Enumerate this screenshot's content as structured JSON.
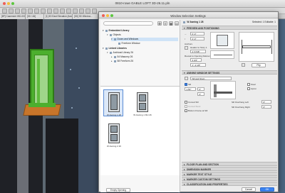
{
  "app": {
    "title": "0810-rowe GABLE LOFT 3D-26.11.pln",
    "tabs": [
      "[8P] Casement WD-000.33",
      "[3D / All]",
      "[1] 3D East Elevation [Auto...]",
      "[3D] 3D Window..."
    ]
  },
  "dialog": {
    "title": "Window Selection Settings",
    "selected_label": "W Awning 1 28",
    "selected_count": "Selected: 1 Editable: 1",
    "search_placeholder": "",
    "tree": [
      {
        "label": "Embedded Library",
        "bold": true
      },
      {
        "label": "Objects",
        "bold": false
      },
      {
        "label": "Doors and Windows",
        "bold": false
      },
      {
        "label": "Freeform Window",
        "bold": false
      },
      {
        "label": "Linked Libraries",
        "bold": true
      },
      {
        "label": "Archicad Library 26",
        "bold": false
      },
      {
        "label": "54 Masonry 26",
        "bold": false
      },
      {
        "label": "58 Freeform 26",
        "bold": false
      }
    ],
    "thumbnails": [
      {
        "label": "W Awning 1 28",
        "selected": true
      },
      {
        "label": "W Awning 1 MU 26",
        "selected": false
      },
      {
        "label": "W Awning 2 26",
        "selected": false
      }
    ],
    "empty_opening_button": "Empty Opening",
    "preview": {
      "header": "PREVIEW AND POSITIONING",
      "width_value": "0'-0\"",
      "height_value": "2'-0\"",
      "anchors_label": "Anchors",
      "header_ref_label": "Header to Story 1",
      "header_value": "4'-5 5/8\"",
      "reveal_label": "Reveal to Opening Reference",
      "reveal_value": "3 3/4\"",
      "sill_value": "1' -2 1/8\"",
      "flip_button": "Flip"
    },
    "awning": {
      "header": "AWNING WINDOW SETTINGS",
      "dropdown_label": "Sill and Stool...",
      "sill_checkbox": "Sill",
      "sill_checked": true,
      "stool_checkbox": "Stool",
      "stool_checked": false,
      "apron_label": "Apron",
      "sill_thickness": "1.50\"",
      "val_a": "0\"",
      "sill_depth": "2\"",
      "curved_sill": "Curved Sill",
      "curved_stool": "Curved Stool",
      "bottom_frame": "Bottom Frame at Sill",
      "overhang_left_label": "Sill Overhang Left",
      "overhang_right_label": "Sill Overhang Right",
      "overhang_left": "0\"",
      "overhang_right": "0\""
    },
    "sections": [
      "FLOOR PLAN AND SECTION",
      "DIMENSION MARKER",
      "MARKER TEXT STYLE",
      "MARKER CUSTOM SETTINGS",
      "CLASSIFICATION AND PROPERTIES"
    ],
    "cancel_label": "Cancel",
    "ok_label": "OK"
  },
  "colors": {
    "accent": "#3a82f0",
    "selection_green": "#4caf2e",
    "sill_orange": "#c8752a"
  }
}
